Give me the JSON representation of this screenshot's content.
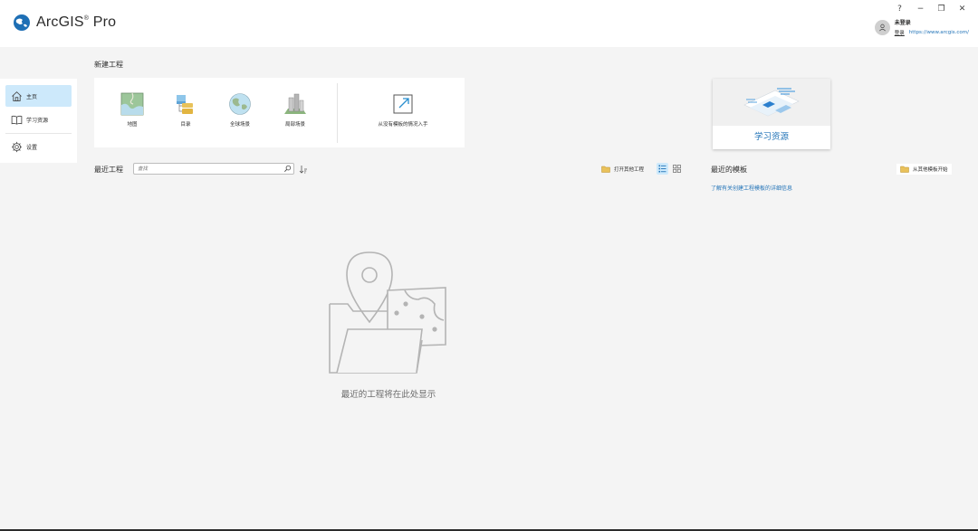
{
  "app": {
    "title": "ArcGIS",
    "title_suffix": "Pro",
    "registered_mark": "®"
  },
  "window_controls": {
    "help": "?",
    "minimize": "−",
    "restore": "❐",
    "close": "✕"
  },
  "user": {
    "status": "未登录",
    "signin": "登录",
    "url": "https://www.arcgis.com/"
  },
  "sidebar": {
    "items": [
      {
        "label": "主页",
        "icon": "home-icon",
        "active": true
      },
      {
        "label": "学习资源",
        "icon": "book-icon",
        "active": false
      },
      {
        "label": "设置",
        "icon": "gear-icon",
        "active": false
      }
    ]
  },
  "new_project": {
    "title": "新建工程",
    "tiles": [
      {
        "label": "地图",
        "icon": "map-icon"
      },
      {
        "label": "目录",
        "icon": "catalog-icon"
      },
      {
        "label": "全球场景",
        "icon": "globe-icon"
      },
      {
        "label": "局部场景",
        "icon": "local-scene-icon"
      },
      {
        "label": "从没有模板的情况入手",
        "icon": "start-without-template-icon"
      }
    ]
  },
  "recent_projects": {
    "title": "最近工程",
    "search_placeholder": "查找",
    "open_other_label": "打开其他工程",
    "empty_message": "最近的工程将在此处显示"
  },
  "learning": {
    "card_label": "学习资源"
  },
  "recent_templates": {
    "title": "最近的模板",
    "start_other_label": "从其他模板开始",
    "info_link": "了解有关创建工程模板的详细信息"
  },
  "colors": {
    "accent": "#2374b8",
    "active_nav": "#cde9fb",
    "background": "#f4f4f4",
    "panel": "#ffffff"
  }
}
